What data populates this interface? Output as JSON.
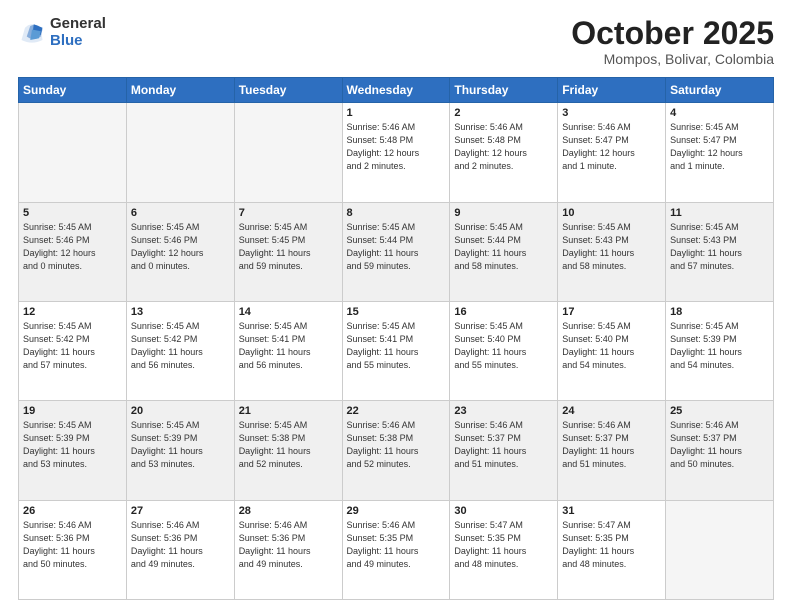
{
  "logo": {
    "general": "General",
    "blue": "Blue"
  },
  "header": {
    "month": "October 2025",
    "location": "Mompos, Bolivar, Colombia"
  },
  "weekdays": [
    "Sunday",
    "Monday",
    "Tuesday",
    "Wednesday",
    "Thursday",
    "Friday",
    "Saturday"
  ],
  "weeks": [
    [
      {
        "day": "",
        "info": "",
        "empty": true
      },
      {
        "day": "",
        "info": "",
        "empty": true
      },
      {
        "day": "",
        "info": "",
        "empty": true
      },
      {
        "day": "1",
        "info": "Sunrise: 5:46 AM\nSunset: 5:48 PM\nDaylight: 12 hours\nand 2 minutes.",
        "empty": false
      },
      {
        "day": "2",
        "info": "Sunrise: 5:46 AM\nSunset: 5:48 PM\nDaylight: 12 hours\nand 2 minutes.",
        "empty": false
      },
      {
        "day": "3",
        "info": "Sunrise: 5:46 AM\nSunset: 5:47 PM\nDaylight: 12 hours\nand 1 minute.",
        "empty": false
      },
      {
        "day": "4",
        "info": "Sunrise: 5:45 AM\nSunset: 5:47 PM\nDaylight: 12 hours\nand 1 minute.",
        "empty": false
      }
    ],
    [
      {
        "day": "5",
        "info": "Sunrise: 5:45 AM\nSunset: 5:46 PM\nDaylight: 12 hours\nand 0 minutes.",
        "empty": false
      },
      {
        "day": "6",
        "info": "Sunrise: 5:45 AM\nSunset: 5:46 PM\nDaylight: 12 hours\nand 0 minutes.",
        "empty": false
      },
      {
        "day": "7",
        "info": "Sunrise: 5:45 AM\nSunset: 5:45 PM\nDaylight: 11 hours\nand 59 minutes.",
        "empty": false
      },
      {
        "day": "8",
        "info": "Sunrise: 5:45 AM\nSunset: 5:44 PM\nDaylight: 11 hours\nand 59 minutes.",
        "empty": false
      },
      {
        "day": "9",
        "info": "Sunrise: 5:45 AM\nSunset: 5:44 PM\nDaylight: 11 hours\nand 58 minutes.",
        "empty": false
      },
      {
        "day": "10",
        "info": "Sunrise: 5:45 AM\nSunset: 5:43 PM\nDaylight: 11 hours\nand 58 minutes.",
        "empty": false
      },
      {
        "day": "11",
        "info": "Sunrise: 5:45 AM\nSunset: 5:43 PM\nDaylight: 11 hours\nand 57 minutes.",
        "empty": false
      }
    ],
    [
      {
        "day": "12",
        "info": "Sunrise: 5:45 AM\nSunset: 5:42 PM\nDaylight: 11 hours\nand 57 minutes.",
        "empty": false
      },
      {
        "day": "13",
        "info": "Sunrise: 5:45 AM\nSunset: 5:42 PM\nDaylight: 11 hours\nand 56 minutes.",
        "empty": false
      },
      {
        "day": "14",
        "info": "Sunrise: 5:45 AM\nSunset: 5:41 PM\nDaylight: 11 hours\nand 56 minutes.",
        "empty": false
      },
      {
        "day": "15",
        "info": "Sunrise: 5:45 AM\nSunset: 5:41 PM\nDaylight: 11 hours\nand 55 minutes.",
        "empty": false
      },
      {
        "day": "16",
        "info": "Sunrise: 5:45 AM\nSunset: 5:40 PM\nDaylight: 11 hours\nand 55 minutes.",
        "empty": false
      },
      {
        "day": "17",
        "info": "Sunrise: 5:45 AM\nSunset: 5:40 PM\nDaylight: 11 hours\nand 54 minutes.",
        "empty": false
      },
      {
        "day": "18",
        "info": "Sunrise: 5:45 AM\nSunset: 5:39 PM\nDaylight: 11 hours\nand 54 minutes.",
        "empty": false
      }
    ],
    [
      {
        "day": "19",
        "info": "Sunrise: 5:45 AM\nSunset: 5:39 PM\nDaylight: 11 hours\nand 53 minutes.",
        "empty": false
      },
      {
        "day": "20",
        "info": "Sunrise: 5:45 AM\nSunset: 5:39 PM\nDaylight: 11 hours\nand 53 minutes.",
        "empty": false
      },
      {
        "day": "21",
        "info": "Sunrise: 5:45 AM\nSunset: 5:38 PM\nDaylight: 11 hours\nand 52 minutes.",
        "empty": false
      },
      {
        "day": "22",
        "info": "Sunrise: 5:46 AM\nSunset: 5:38 PM\nDaylight: 11 hours\nand 52 minutes.",
        "empty": false
      },
      {
        "day": "23",
        "info": "Sunrise: 5:46 AM\nSunset: 5:37 PM\nDaylight: 11 hours\nand 51 minutes.",
        "empty": false
      },
      {
        "day": "24",
        "info": "Sunrise: 5:46 AM\nSunset: 5:37 PM\nDaylight: 11 hours\nand 51 minutes.",
        "empty": false
      },
      {
        "day": "25",
        "info": "Sunrise: 5:46 AM\nSunset: 5:37 PM\nDaylight: 11 hours\nand 50 minutes.",
        "empty": false
      }
    ],
    [
      {
        "day": "26",
        "info": "Sunrise: 5:46 AM\nSunset: 5:36 PM\nDaylight: 11 hours\nand 50 minutes.",
        "empty": false
      },
      {
        "day": "27",
        "info": "Sunrise: 5:46 AM\nSunset: 5:36 PM\nDaylight: 11 hours\nand 49 minutes.",
        "empty": false
      },
      {
        "day": "28",
        "info": "Sunrise: 5:46 AM\nSunset: 5:36 PM\nDaylight: 11 hours\nand 49 minutes.",
        "empty": false
      },
      {
        "day": "29",
        "info": "Sunrise: 5:46 AM\nSunset: 5:35 PM\nDaylight: 11 hours\nand 49 minutes.",
        "empty": false
      },
      {
        "day": "30",
        "info": "Sunrise: 5:47 AM\nSunset: 5:35 PM\nDaylight: 11 hours\nand 48 minutes.",
        "empty": false
      },
      {
        "day": "31",
        "info": "Sunrise: 5:47 AM\nSunset: 5:35 PM\nDaylight: 11 hours\nand 48 minutes.",
        "empty": false
      },
      {
        "day": "",
        "info": "",
        "empty": true
      }
    ]
  ]
}
